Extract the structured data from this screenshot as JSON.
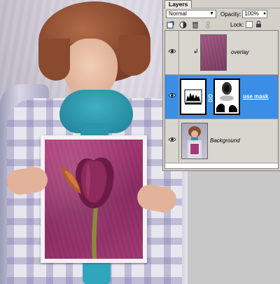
{
  "panel": {
    "tab_label": "Layers",
    "blend_mode": "Normal",
    "opacity_label": "Opacity:",
    "opacity_value": "100%",
    "lock_label": "Lock:",
    "layers": [
      {
        "name": "overlay",
        "visible": true,
        "clipped": true,
        "selected": false
      },
      {
        "name": "use mask",
        "visible": true,
        "clipped": false,
        "selected": true
      },
      {
        "name": "Background",
        "visible": true,
        "clipped": false,
        "selected": false
      }
    ]
  },
  "icons": {
    "new_fill": "new-fill-layer-icon",
    "adjust": "adjustment-layer-icon",
    "trash": "trash-icon",
    "link": "link-icon",
    "lock_transparency": "lock-transparency-icon",
    "lock_all": "lock-icon",
    "eye": "eye-icon",
    "clip": "clip-arrow-icon",
    "chain": "chain-icon"
  },
  "colors": {
    "selection": "#3a8ee6",
    "panel_bg": "#d4d0c8",
    "paper_art": "#8b2d63"
  }
}
